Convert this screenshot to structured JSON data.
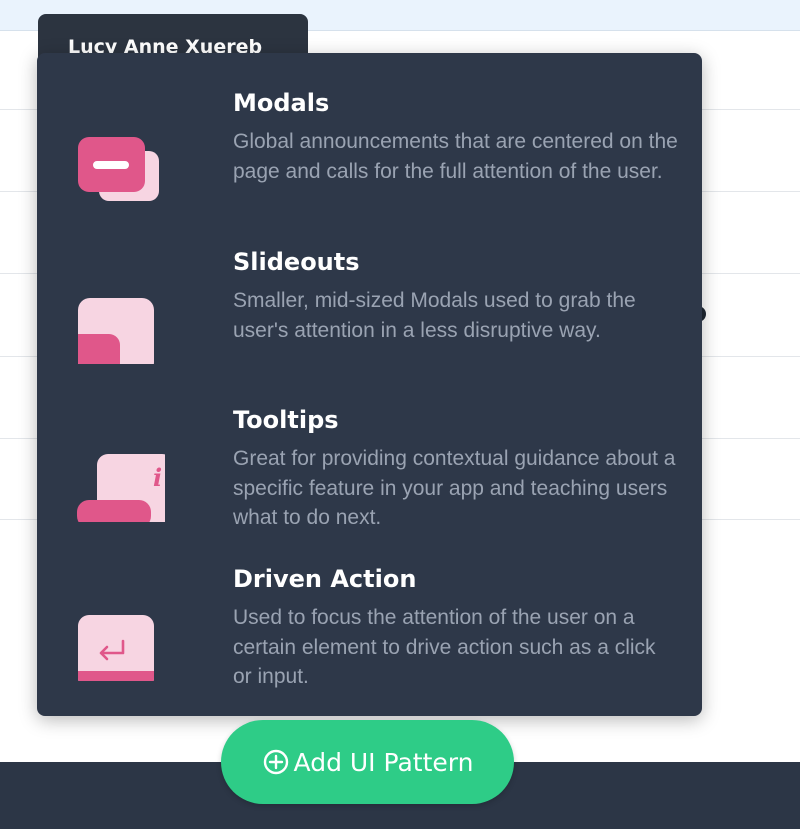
{
  "user": {
    "name": "Lucy Anne Xuereb"
  },
  "menu": {
    "items": [
      {
        "title": "Modals",
        "description": "Global announcements that are centered on the page and calls for the full attention of the user.",
        "icon": "modal-icon"
      },
      {
        "title": "Slideouts",
        "description": "Smaller, mid-sized Modals used to grab the user's attention in a less disruptive way.",
        "icon": "slideout-icon"
      },
      {
        "title": "Tooltips",
        "description": "Great for providing contextual guidance about a specific feature in your app and teaching users what to do next.",
        "icon": "tooltip-icon"
      },
      {
        "title": "Driven Action",
        "description": "Used to focus the attention of the user on a certain element to drive action such as a click or input.",
        "icon": "driven-action-icon"
      }
    ]
  },
  "footer": {
    "add_button_label": "Add UI Pattern",
    "add_button_icon": "plus-circle-icon"
  },
  "colors": {
    "accent_pink": "#e0578a",
    "light_pink": "#f7d5e2",
    "panel_bg": "#2e3849",
    "button_green": "#2ecc87"
  }
}
